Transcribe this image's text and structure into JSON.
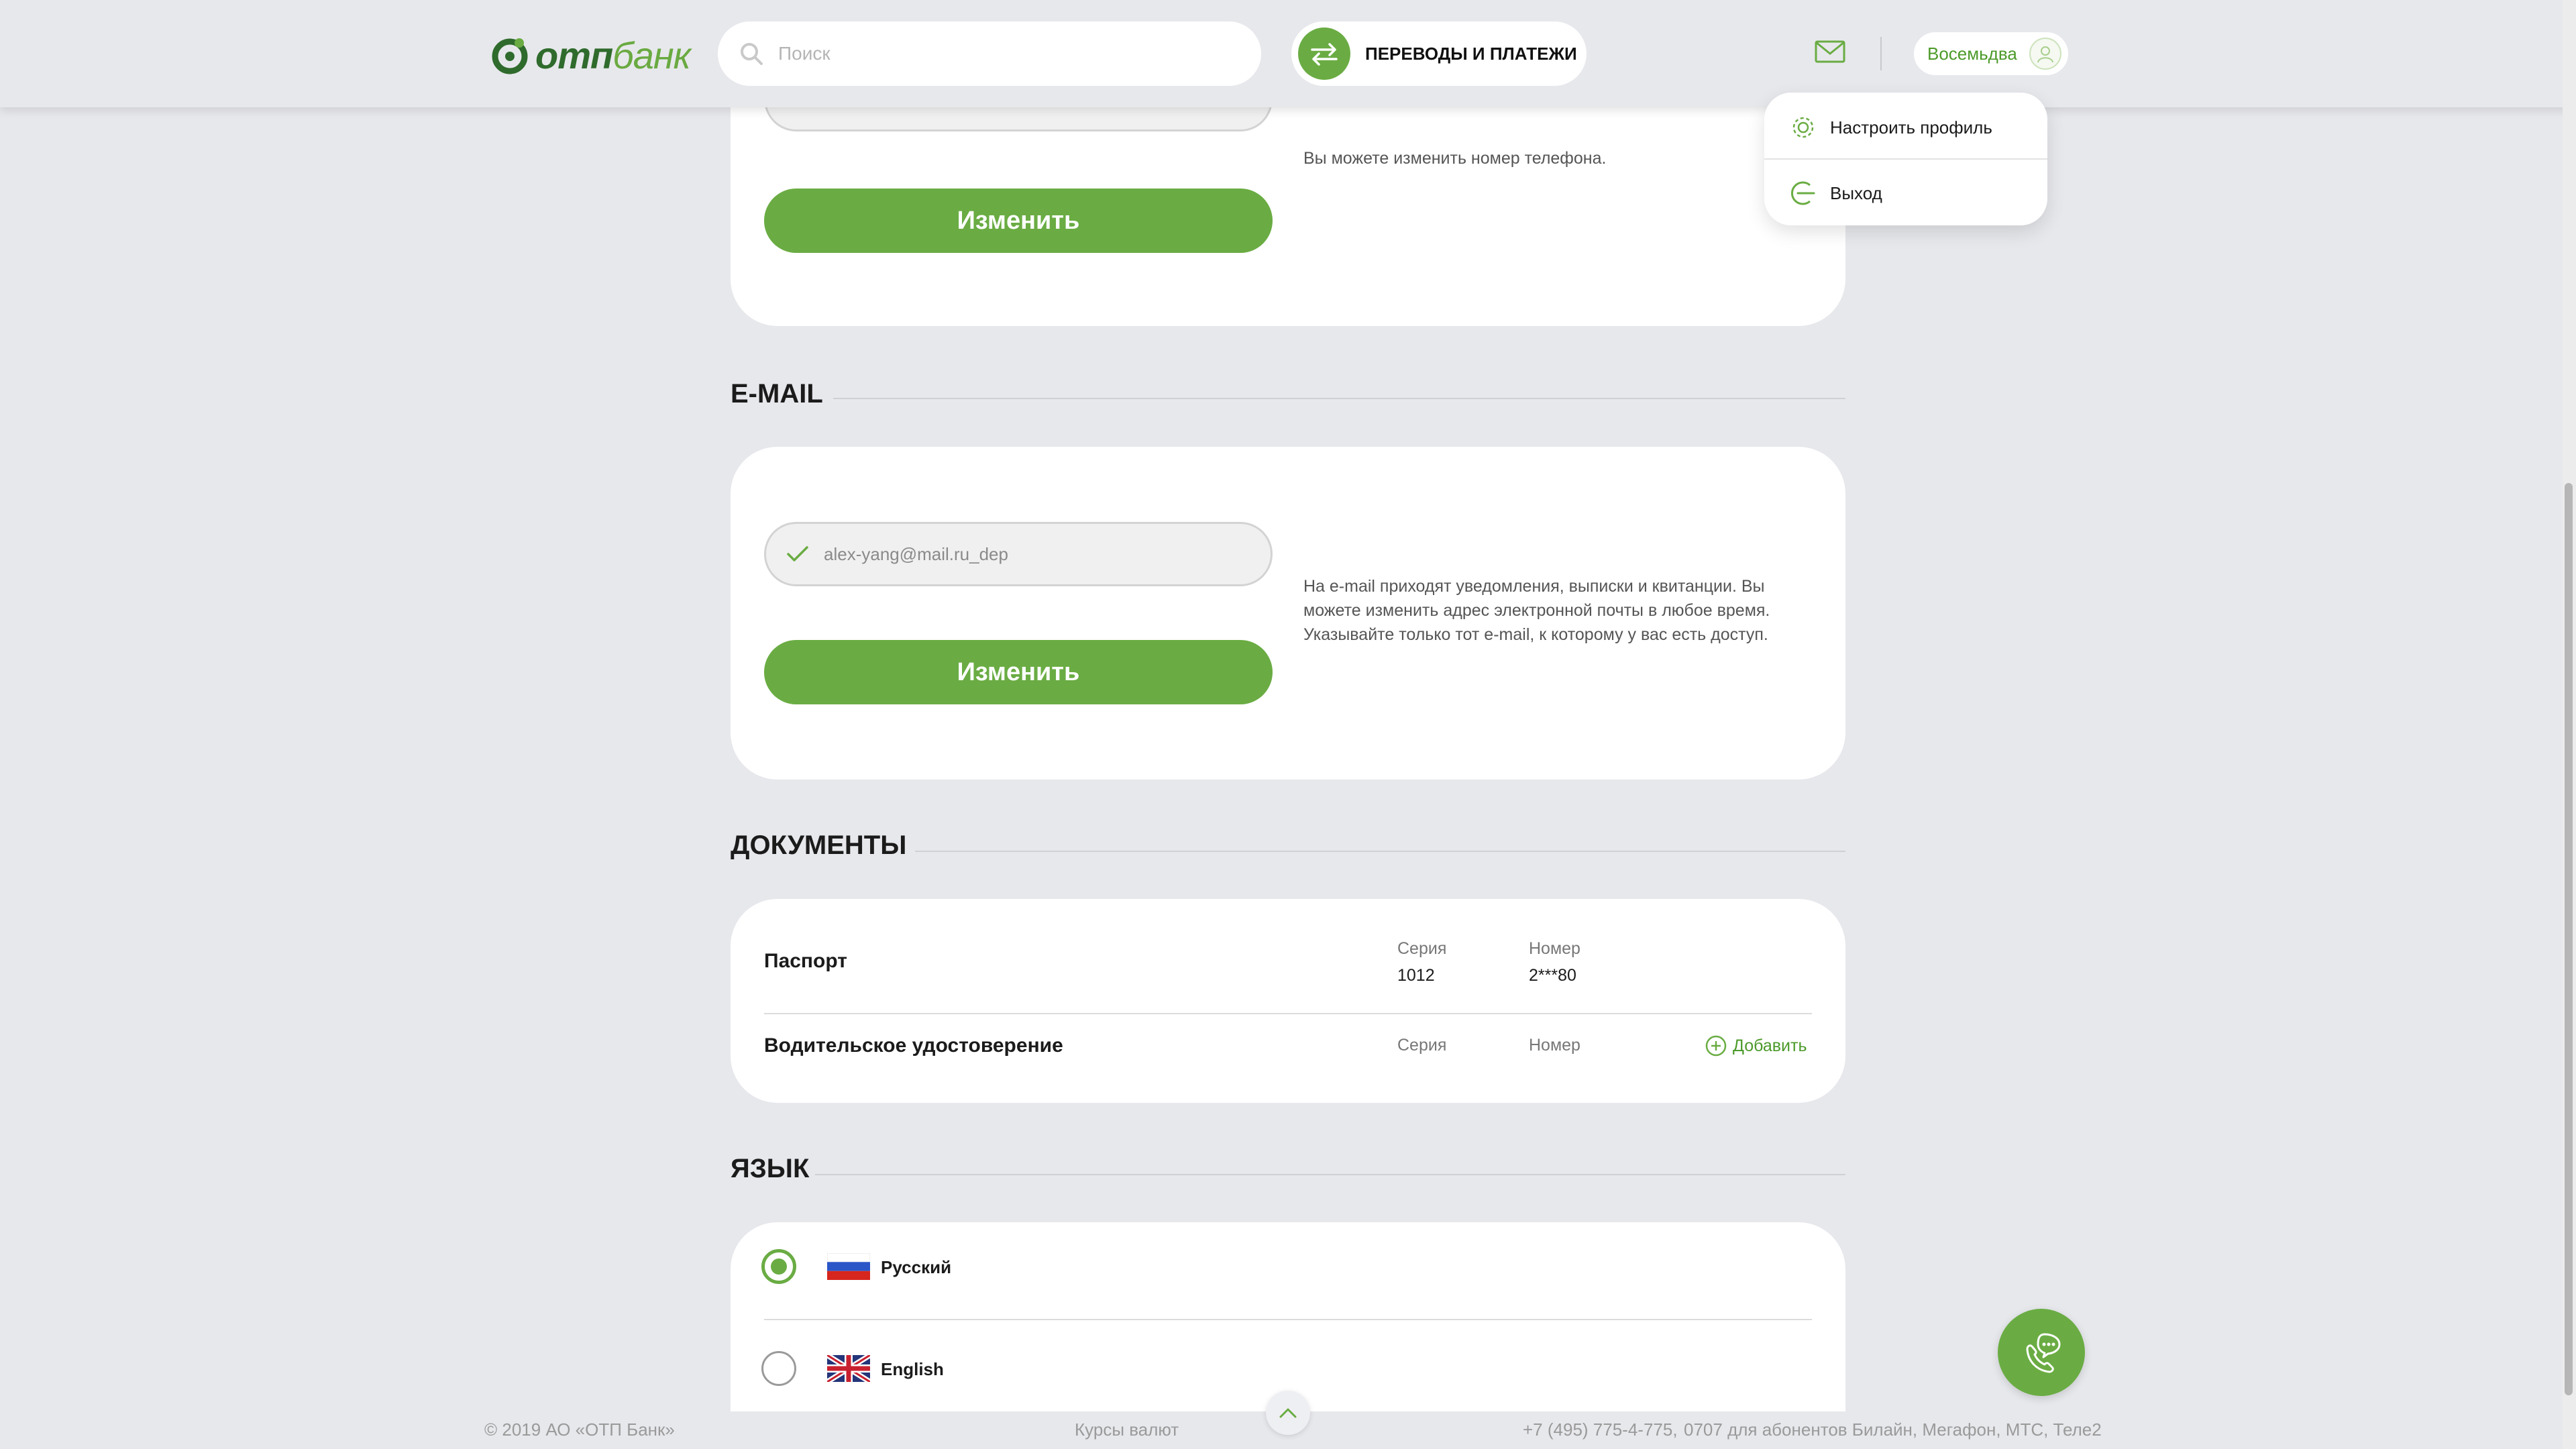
{
  "header": {
    "logo_bold": "отп",
    "logo_thin": "банк",
    "search_placeholder": "Поиск",
    "transfers_label": "ПЕРЕВОДЫ И ПЛАТЕЖИ",
    "user_name": "Восемьдва"
  },
  "dropdown": {
    "items": [
      {
        "label": "Настроить профиль",
        "icon": "gear-icon"
      },
      {
        "label": "Выход",
        "icon": "logout-icon"
      }
    ]
  },
  "phone": {
    "button_label": "Изменить",
    "hint": "Вы можете изменить номер телефона."
  },
  "email": {
    "title": "E-MAIL",
    "value": "alex-yang@mail.ru_dep",
    "button_label": "Изменить",
    "hint_lines": [
      "На e-mail приходят уведомления, выписки и квитанции. Вы",
      "можете изменить адрес электронной почты в любое время.",
      "Указывайте только тот e-mail, к которому у вас есть доступ."
    ]
  },
  "documents": {
    "title": "ДОКУМЕНТЫ",
    "rows": [
      {
        "name": "Паспорт",
        "series_label": "Серия",
        "series": "1012",
        "number_label": "Номер",
        "number": "2***80"
      },
      {
        "name": "Водительское удостоверение",
        "series_label": "Серия",
        "number_label": "Номер",
        "add_label": "Добавить"
      }
    ]
  },
  "language": {
    "title": "ЯЗЫК",
    "options": [
      {
        "label": "Русский",
        "selected": true
      },
      {
        "label": "English",
        "selected": false
      }
    ]
  },
  "footer": {
    "copyright": "© 2019 АО «ОТП Банк»",
    "rates": "Курсы валют",
    "phone": "+7 (495) 775-4-775,",
    "short_number": "0707 для абонентов Билайн, Мегафон, МТС, Теле2"
  },
  "colors": {
    "accent": "#6aac43",
    "brand_dark": "#2f6b2c",
    "background": "#e7e8ec"
  }
}
